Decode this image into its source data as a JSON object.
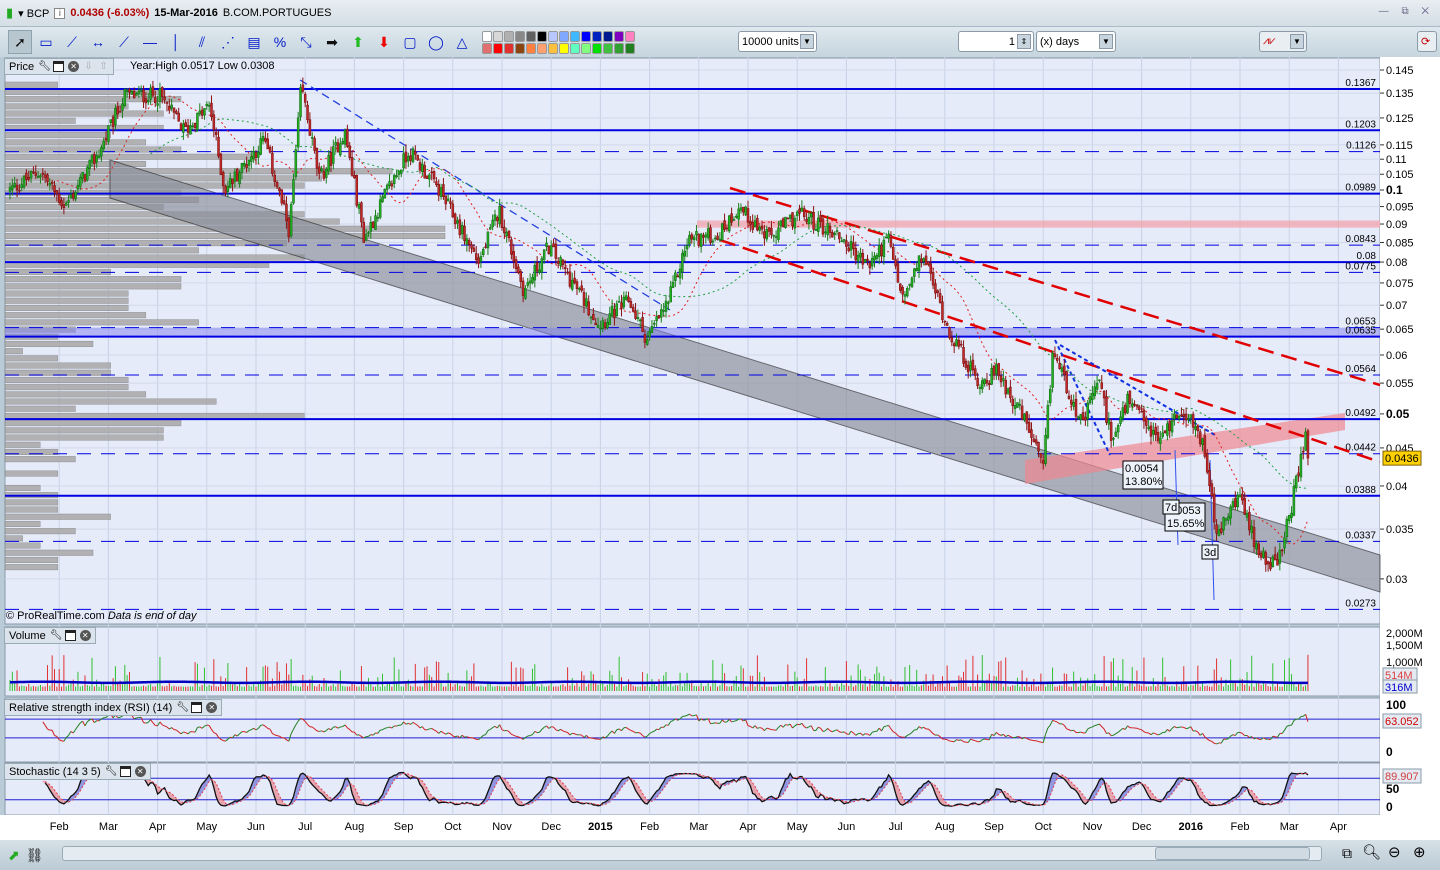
{
  "header": {
    "symbol": "BCP",
    "price_change": "0.0436 (-6.03%)",
    "date": "15-Mar-2016",
    "name": "B.COM.PORTUGUES",
    "window_controls": "— ⧉ ✕"
  },
  "toolbar": {
    "units": "10000 units",
    "period_value": "1",
    "period_unit": "(x) days",
    "tools": [
      "pointer-icon",
      "ruler-icon",
      "line-icon",
      "horizontal-measure-icon",
      "trendline-icon",
      "horizontal-line-icon",
      "vertical-line-icon",
      "channel-icon",
      "fan-icon",
      "fibonacci-icon",
      "percent-icon",
      "arrow-points-icon",
      "right-arrow-icon",
      "up-arrow-icon",
      "down-arrow-icon",
      "rectangle-icon",
      "ellipse-icon",
      "triangle-icon"
    ],
    "tool_glyphs": [
      "➚",
      "▭",
      "⟋",
      "↔",
      "⟋",
      "—",
      "│",
      "⫽",
      "⋰",
      "▤",
      "%",
      "⤡",
      "➡",
      "⬆",
      "⬇",
      "▢",
      "◯",
      "△"
    ],
    "palette": [
      "#ffffff",
      "#d8d8d8",
      "#b0b0b0",
      "#888888",
      "#606060",
      "#000000",
      "#b8c8ff",
      "#80a8ff",
      "#40b8ff",
      "#0000ff",
      "#0020c0",
      "#001890",
      "#8000c0",
      "#ff80c0",
      "#e07070",
      "#ff0000",
      "#e03030",
      "#8b4513",
      "#ff8040",
      "#ffa070",
      "#ffc040",
      "#ffff00",
      "#60ffc0",
      "#80ff80",
      "#00e000",
      "#40c040",
      "#30a030",
      "#208020"
    ]
  },
  "panels": {
    "price": {
      "label": "Price",
      "info": "Year:High 0.0517 Low 0.0308",
      "copyright": "© ProRealTime.com",
      "note": "Data is end of day"
    },
    "volume": {
      "label": "Volume",
      "ticks": [
        "2,000M",
        "1,500M",
        "1,000M"
      ],
      "last": "514M",
      "avg": "316M"
    },
    "rsi": {
      "label": "Relative strength index (RSI) (14)",
      "ticks": [
        "100",
        "0"
      ],
      "last": "63.052"
    },
    "stoch": {
      "label": "Stochastic (14 3 5)",
      "ticks": [
        "50",
        "0"
      ],
      "last": "89.907"
    }
  },
  "colors": {
    "up": "#22b022",
    "down": "#c02828",
    "line": "#0000e0",
    "trend": "#e00000",
    "current": "#ffd000"
  },
  "chart_data": {
    "type": "candlestick",
    "scale": "log",
    "symbol": "BCP",
    "last_price": "0.0436",
    "y_ticks": [
      "0.145",
      "0.135",
      "0.125",
      "0.115",
      "0.11",
      "0.105",
      "0.1",
      "0.095",
      "0.09",
      "0.085",
      "0.08",
      "0.075",
      "0.07",
      "0.065",
      "0.06",
      "0.055",
      "0.05",
      "0.045",
      "0.04",
      "0.035",
      "0.03"
    ],
    "x_ticks": [
      {
        "m": 1,
        "t": "Feb"
      },
      {
        "m": 2,
        "t": "Mar"
      },
      {
        "m": 3,
        "t": "Apr"
      },
      {
        "m": 4,
        "t": "May"
      },
      {
        "m": 5,
        "t": "Jun"
      },
      {
        "m": 6,
        "t": "Jul"
      },
      {
        "m": 7,
        "t": "Aug"
      },
      {
        "m": 8,
        "t": "Sep"
      },
      {
        "m": 9,
        "t": "Oct"
      },
      {
        "m": 10,
        "t": "Nov"
      },
      {
        "m": 11,
        "t": "Dec"
      },
      {
        "m": 12,
        "t": "2015"
      },
      {
        "m": 13,
        "t": "Feb"
      },
      {
        "m": 14,
        "t": "Mar"
      },
      {
        "m": 15,
        "t": "Apr"
      },
      {
        "m": 16,
        "t": "May"
      },
      {
        "m": 17,
        "t": "Jun"
      },
      {
        "m": 18,
        "t": "Jul"
      },
      {
        "m": 19,
        "t": "Aug"
      },
      {
        "m": 20,
        "t": "Sep"
      },
      {
        "m": 21,
        "t": "Oct"
      },
      {
        "m": 22,
        "t": "Nov"
      },
      {
        "m": 23,
        "t": "Dec"
      },
      {
        "m": 24,
        "t": "2016"
      },
      {
        "m": 25,
        "t": "Feb"
      },
      {
        "m": 26,
        "t": "Mar"
      },
      {
        "m": 27,
        "t": "Apr"
      }
    ],
    "price_path_months_since_jan2014": [
      [
        0,
        0.1
      ],
      [
        0.61,
        0.106
      ],
      [
        1.12,
        0.095
      ],
      [
        1.83,
        0.113
      ],
      [
        2.33,
        0.134
      ],
      [
        3.04,
        0.134
      ],
      [
        3.55,
        0.12
      ],
      [
        4.06,
        0.13
      ],
      [
        4.36,
        0.1
      ],
      [
        5.17,
        0.117
      ],
      [
        5.68,
        0.088
      ],
      [
        5.92,
        0.138
      ],
      [
        6.29,
        0.103
      ],
      [
        6.8,
        0.12
      ],
      [
        7.2,
        0.086
      ],
      [
        7.61,
        0.098
      ],
      [
        8.11,
        0.113
      ],
      [
        8.72,
        0.1
      ],
      [
        9.53,
        0.08
      ],
      [
        9.94,
        0.094
      ],
      [
        10.45,
        0.073
      ],
      [
        10.95,
        0.084
      ],
      [
        11.56,
        0.073
      ],
      [
        11.97,
        0.066
      ],
      [
        12.58,
        0.071
      ],
      [
        12.94,
        0.063
      ],
      [
        13.39,
        0.071
      ],
      [
        13.79,
        0.086
      ],
      [
        14.4,
        0.087
      ],
      [
        14.81,
        0.095
      ],
      [
        15.42,
        0.086
      ],
      [
        16.02,
        0.093
      ],
      [
        16.84,
        0.087
      ],
      [
        17.44,
        0.079
      ],
      [
        17.85,
        0.086
      ],
      [
        18.15,
        0.071
      ],
      [
        18.56,
        0.082
      ],
      [
        19.07,
        0.065
      ],
      [
        19.68,
        0.055
      ],
      [
        20.08,
        0.057
      ],
      [
        20.69,
        0.048
      ],
      [
        21.0,
        0.042
      ],
      [
        21.2,
        0.061
      ],
      [
        21.8,
        0.048
      ],
      [
        22.11,
        0.056
      ],
      [
        22.41,
        0.046
      ],
      [
        22.72,
        0.052
      ],
      [
        23.33,
        0.046
      ],
      [
        23.83,
        0.051
      ],
      [
        24.24,
        0.046
      ],
      [
        24.54,
        0.034
      ],
      [
        24.95,
        0.039
      ],
      [
        25.35,
        0.033
      ],
      [
        25.76,
        0.031
      ],
      [
        26.06,
        0.038
      ],
      [
        26.37,
        0.048
      ],
      [
        26.41,
        0.0436
      ]
    ],
    "levels_solid": [
      {
        "v": 0.1367,
        "t": "0.1367"
      },
      {
        "v": 0.1203,
        "t": "0.1203"
      },
      {
        "v": 0.0989,
        "t": "0.0989"
      },
      {
        "v": 0.08,
        "t": "0.08"
      },
      {
        "v": 0.0635,
        "t": "0.0635"
      },
      {
        "v": 0.0492,
        "t": "0.0492"
      },
      {
        "v": 0.0388,
        "t": "0.0388"
      }
    ],
    "levels_dashed": [
      {
        "v": 0.1126,
        "t": "0.1126"
      },
      {
        "v": 0.0843,
        "t": "0.0843"
      },
      {
        "v": 0.0775,
        "t": "0.0775"
      },
      {
        "v": 0.0653,
        "t": "0.0653"
      },
      {
        "v": 0.0564,
        "t": "0.0564"
      },
      {
        "v": 0.0442,
        "t": "0.0442"
      },
      {
        "v": 0.0337,
        "t": "0.0337"
      },
      {
        "v": 0.0273,
        "t": "0.0273"
      }
    ],
    "annotations": [
      {
        "t1": "0.0054",
        "t2": "13.80%"
      },
      {
        "t1": "0.0053",
        "t2": "15.65%"
      },
      {
        "t1": "7d"
      },
      {
        "t1": "3d"
      }
    ],
    "rsi_levels": [
      70,
      30
    ],
    "stoch_levels": [
      80,
      20
    ]
  }
}
